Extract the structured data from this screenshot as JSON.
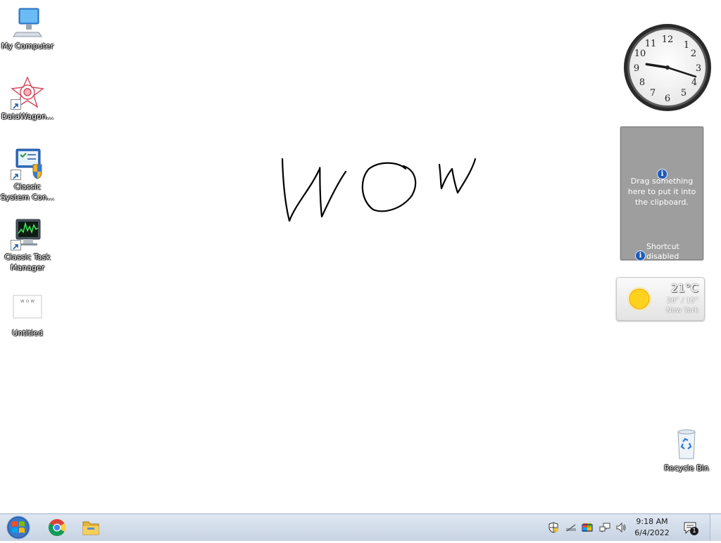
{
  "desktop": {
    "icons": [
      {
        "label": "My Computer",
        "icon": "computer-icon"
      },
      {
        "label": "DataWagon...",
        "icon": "datawagon-icon"
      },
      {
        "label": "Classic\nSystem Con...",
        "icon": "control-panel-icon"
      },
      {
        "label": "Classic Task\nManager",
        "icon": "task-manager-icon"
      },
      {
        "label": "Untitled",
        "icon": "image-file-icon"
      },
      {
        "label": "Recycle Bin",
        "icon": "recycle-bin-icon"
      }
    ],
    "drawing_text": "WOW"
  },
  "gadgets": {
    "clock": {
      "hour": 9,
      "minute": 18
    },
    "clipboard": {
      "message": "Drag something here to put it into the clipboard.",
      "shortcut": "Shortcut disabled"
    },
    "weather": {
      "temp": "21°C",
      "range": "26° / 15°",
      "city": "New York"
    }
  },
  "taskbar": {
    "start": "start-button",
    "apps": [
      "chrome-icon",
      "file-explorer-icon"
    ],
    "tray": [
      "security-shield-icon",
      "network-disconnected-icon",
      "flag-icon",
      "network-icon",
      "volume-icon"
    ],
    "time": "9:18 AM",
    "date": "6/4/2022",
    "notification_count": "1"
  },
  "colors": {
    "taskbar_top": "#dfe7f1",
    "taskbar_bottom": "#c7d3e3",
    "clip_bg": "#9e9e9e"
  }
}
